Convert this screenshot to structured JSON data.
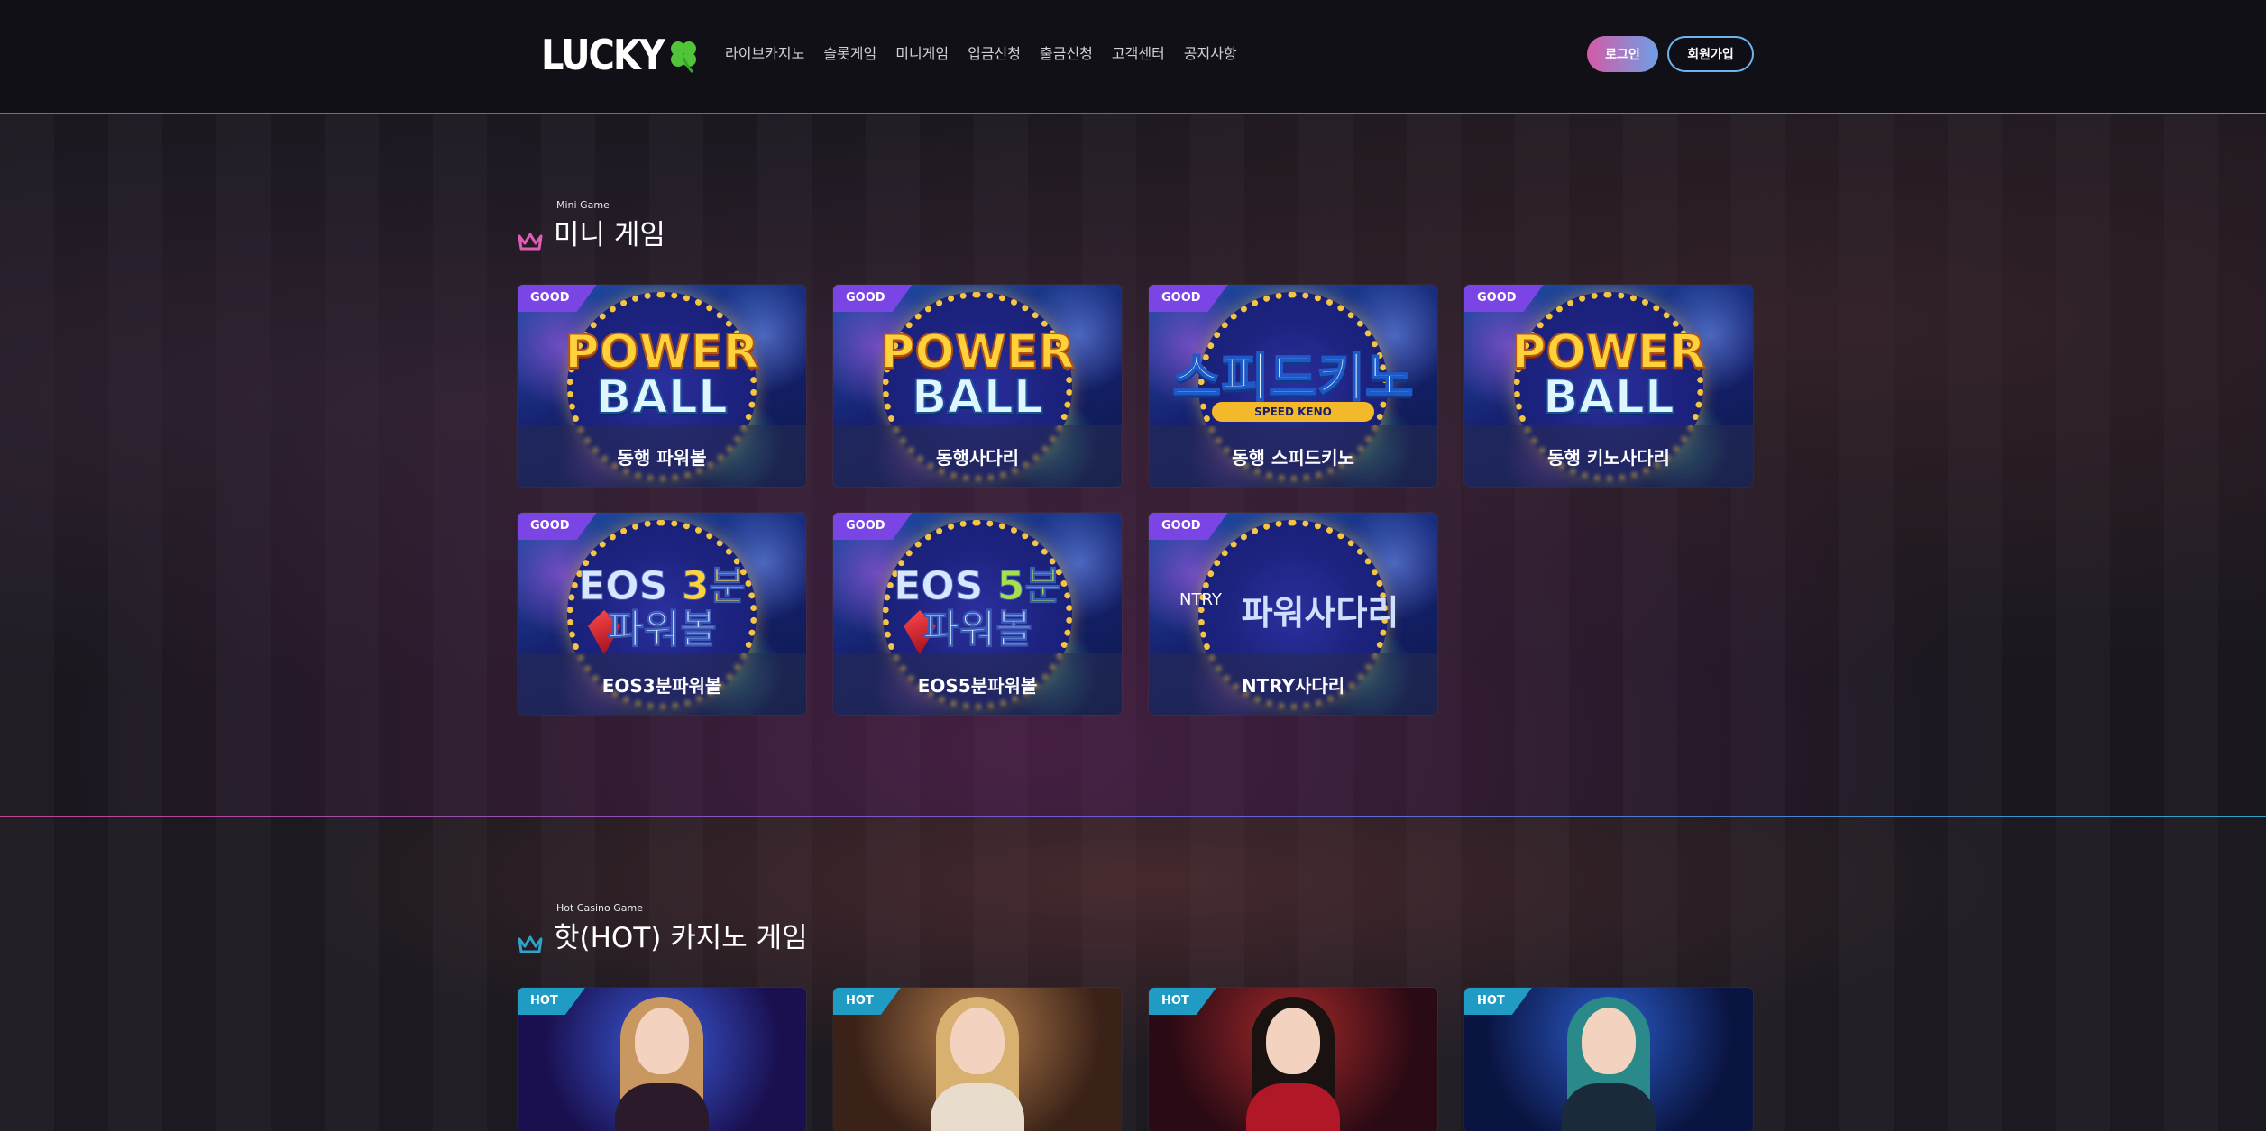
{
  "header": {
    "logo_text": "LUCKY",
    "logo_icon": "clover-icon",
    "nav": [
      "라이브카지노",
      "슬롯게임",
      "미니게임",
      "입금신청",
      "출금신청",
      "고객센터",
      "공지사항"
    ],
    "login_label": "로그인",
    "signup_label": "회원가입"
  },
  "mini_section": {
    "subtitle": "Mini Game",
    "title": "미니 게임",
    "icon": "crown-icon",
    "accent": "#e25bb4",
    "cards": [
      {
        "badge": "GOOD",
        "art_line1": "POWER",
        "art_line2": "BALL",
        "label": "동행 파워볼"
      },
      {
        "badge": "GOOD",
        "art_line1": "POWER",
        "art_line2": "BALL",
        "label": "동행사다리"
      },
      {
        "badge": "GOOD",
        "art_line1": "스피드키노",
        "art_line2": "SPEED KENO",
        "label": "동행 스피드키노"
      },
      {
        "badge": "GOOD",
        "art_line1": "POWER",
        "art_line2": "BALL",
        "label": "동행 키노사다리"
      },
      {
        "badge": "GOOD",
        "art_line1": "EOS",
        "art_accent": "3분",
        "art_line2": "파워볼",
        "label": "EOS3분파워볼"
      },
      {
        "badge": "GOOD",
        "art_line1": "EOS",
        "art_accent": "5분",
        "art_line2": "파워볼",
        "label": "EOS5분파워볼"
      },
      {
        "badge": "GOOD",
        "art_logo": "NTRY",
        "art_line1": "파워사다리",
        "label": "NTRY사다리"
      }
    ]
  },
  "hot_section": {
    "subtitle": "Hot Casino Game",
    "title": "핫(HOT) 카지노 게임",
    "icon": "crown-icon",
    "accent": "#2fa4c8",
    "cards": [
      {
        "badge": "HOT"
      },
      {
        "badge": "HOT"
      },
      {
        "badge": "HOT"
      },
      {
        "badge": "HOT"
      }
    ]
  },
  "colors": {
    "background": "#0f0e16",
    "badge_good": "#7b45e6",
    "badge_hot": "#1f9bc4",
    "login_gradient_start": "#d55aa6",
    "login_gradient_end": "#6f9fe6",
    "signup_border": "#6fb4ea"
  }
}
